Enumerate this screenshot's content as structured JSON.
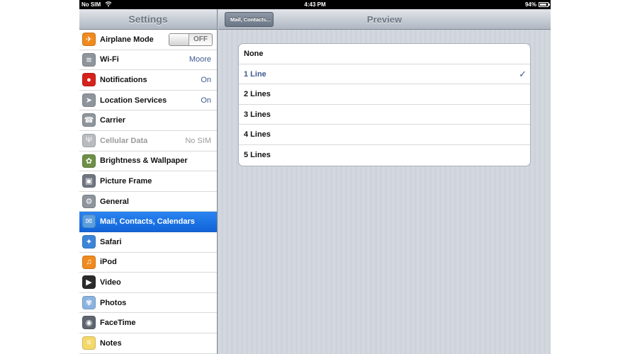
{
  "status_bar": {
    "carrier": "No SIM",
    "time": "4:43 PM",
    "battery": "94%",
    "battery_level": 0.94
  },
  "master": {
    "title": "Settings",
    "items": [
      {
        "label": "Airplane Mode",
        "icon": "airplane-icon",
        "icon_color": "#f08a1e",
        "toggle": "OFF"
      },
      {
        "label": "Wi-Fi",
        "value": "Moore",
        "icon": "wifi-icon",
        "icon_color": "#8f959c"
      },
      {
        "label": "Notifications",
        "value": "On",
        "icon": "notifications-icon",
        "icon_color": "#d5221a"
      },
      {
        "label": "Location Services",
        "value": "On",
        "icon": "location-icon",
        "icon_color": "#8f959c"
      },
      {
        "label": "Carrier",
        "icon": "phone-icon",
        "icon_color": "#8f959c"
      },
      {
        "label": "Cellular Data",
        "value": "No SIM",
        "icon": "cellular-icon",
        "icon_color": "#b8bcc1",
        "disabled": true
      },
      {
        "label": "Brightness & Wallpaper",
        "icon": "brightness-icon",
        "icon_color": "#6d8f46"
      },
      {
        "label": "Picture Frame",
        "icon": "picture-frame-icon",
        "icon_color": "#707680"
      },
      {
        "label": "General",
        "icon": "gear-icon",
        "icon_color": "#8f959c"
      },
      {
        "label": "Mail, Contacts, Calendars",
        "icon": "mail-icon",
        "icon_color": "#5b9ee0",
        "selected": true
      },
      {
        "label": "Safari",
        "icon": "safari-icon",
        "icon_color": "#3b85d8"
      },
      {
        "label": "iPod",
        "icon": "ipod-icon",
        "icon_color": "#f08a1e"
      },
      {
        "label": "Video",
        "icon": "video-icon",
        "icon_color": "#2b2b2b"
      },
      {
        "label": "Photos",
        "icon": "photos-icon",
        "icon_color": "#8ab3e0"
      },
      {
        "label": "FaceTime",
        "icon": "facetime-icon",
        "icon_color": "#5f6670"
      },
      {
        "label": "Notes",
        "icon": "notes-icon",
        "icon_color": "#f4d86a"
      }
    ]
  },
  "detail": {
    "back_label": "Mail, Contacts...",
    "title": "Preview",
    "options": [
      {
        "label": "None",
        "checked": false
      },
      {
        "label": "1 Line",
        "checked": true
      },
      {
        "label": "2 Lines",
        "checked": false
      },
      {
        "label": "3 Lines",
        "checked": false
      },
      {
        "label": "4 Lines",
        "checked": false
      },
      {
        "label": "5 Lines",
        "checked": false
      }
    ],
    "checkmark": "✓"
  }
}
